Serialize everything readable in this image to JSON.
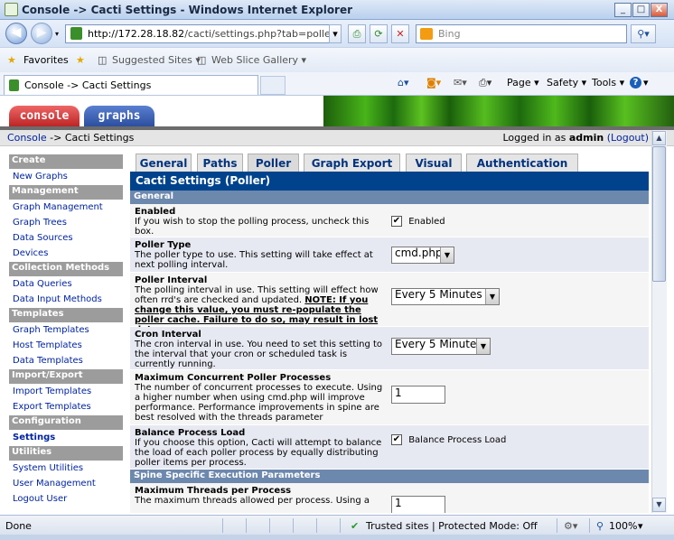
{
  "window": {
    "title": "Console -> Cacti Settings - Windows Internet Explorer",
    "minimize": "_",
    "maximize": "□",
    "close": "X"
  },
  "address_bar": {
    "url_host": "http://172.28.18.82",
    "url_path": "/cacti/settings.php?tab=poller",
    "search_placeholder": "Bing"
  },
  "favorites_bar": {
    "favorites_label": "Favorites",
    "suggested_sites": "Suggested Sites ▾",
    "web_slice_gallery": "Web Slice Gallery ▾"
  },
  "browser_tab": {
    "title": "Console -> Cacti Settings"
  },
  "command_bar": {
    "page": "Page ▾",
    "safety": "Safety ▾",
    "tools": "Tools ▾",
    "help": "?"
  },
  "cacti": {
    "tabs": [
      "console",
      "graphs"
    ],
    "breadcrumb": {
      "console": "Console",
      "sep": " -> ",
      "current": "Cacti Settings"
    },
    "login": {
      "prefix": "Logged in as ",
      "user": "admin",
      "logout": "(Logout)"
    }
  },
  "sidebar": [
    {
      "type": "header",
      "label": "Create"
    },
    {
      "type": "item",
      "label": "New Graphs"
    },
    {
      "type": "header",
      "label": "Management"
    },
    {
      "type": "item",
      "label": "Graph Management"
    },
    {
      "type": "item",
      "label": "Graph Trees"
    },
    {
      "type": "item",
      "label": "Data Sources"
    },
    {
      "type": "item",
      "label": "Devices"
    },
    {
      "type": "header",
      "label": "Collection Methods"
    },
    {
      "type": "item",
      "label": "Data Queries"
    },
    {
      "type": "item",
      "label": "Data Input Methods"
    },
    {
      "type": "header",
      "label": "Templates"
    },
    {
      "type": "item",
      "label": "Graph Templates"
    },
    {
      "type": "item",
      "label": "Host Templates"
    },
    {
      "type": "item",
      "label": "Data Templates"
    },
    {
      "type": "header",
      "label": "Import/Export"
    },
    {
      "type": "item",
      "label": "Import Templates"
    },
    {
      "type": "item",
      "label": "Export Templates"
    },
    {
      "type": "header",
      "label": "Configuration"
    },
    {
      "type": "item",
      "label": "Settings",
      "selected": true
    },
    {
      "type": "header",
      "label": "Utilities"
    },
    {
      "type": "item",
      "label": "System Utilities"
    },
    {
      "type": "item",
      "label": "User Management"
    },
    {
      "type": "item",
      "label": "Logout User"
    }
  ],
  "settings_tabs": [
    "General",
    "Paths",
    "Poller",
    "Graph Export",
    "Visual",
    "Authentication"
  ],
  "settings": {
    "title": "Cacti Settings (Poller)",
    "section_general": "General",
    "section_spine": "Spine Specific Execution Parameters",
    "enabled": {
      "label": "Enabled",
      "desc": "If you wish to stop the polling process, uncheck this box.",
      "checkbox_label": "Enabled",
      "checked": true
    },
    "poller_type": {
      "label": "Poller Type",
      "desc": "The poller type to use. This setting will take effect at next polling interval.",
      "value": "cmd.php"
    },
    "poller_interval": {
      "label": "Poller Interval",
      "desc": "The polling interval in use. This setting will effect how often rrd's are checked and updated. ",
      "note": "NOTE: If you change this value, you must re-populate the poller cache. Failure to do so, may result in lost data.",
      "value": "Every 5 Minutes"
    },
    "cron_interval": {
      "label": "Cron Interval",
      "desc": "The cron interval in use. You need to set this setting to the interval that your cron or scheduled task is currently running.",
      "value": "Every 5 Minutes"
    },
    "max_processes": {
      "label": "Maximum Concurrent Poller Processes",
      "desc": "The number of concurrent processes to execute. Using a higher number when using cmd.php will improve performance. Performance improvements in spine are best resolved with the threads parameter",
      "value": "1"
    },
    "balance_load": {
      "label": "Balance Process Load",
      "desc": "If you choose this option, Cacti will attempt to balance the load of each poller process by equally distributing poller items per process.",
      "checkbox_label": "Balance Process Load",
      "checked": true
    },
    "max_threads": {
      "label": "Maximum Threads per Process",
      "desc": "The maximum threads allowed per process. Using a",
      "value": "1"
    }
  },
  "status_bar": {
    "done": "Done",
    "zone": "Trusted sites | Protected Mode: Off",
    "zoom": "100%"
  }
}
